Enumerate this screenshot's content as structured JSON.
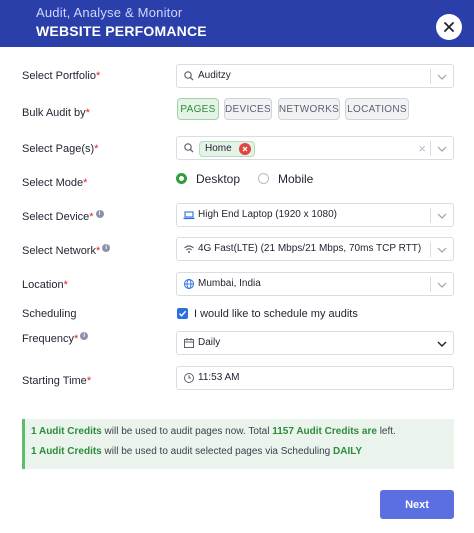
{
  "header": {
    "subtitle": "Audit, Analyse & Monitor",
    "title": "WEBSITE PERFOMANCE",
    "close_icon": "close-icon"
  },
  "form": {
    "portfolio": {
      "label": "Select Portfolio",
      "required": "*",
      "value": "Auditzy",
      "icon": "search-icon"
    },
    "bulk_audit": {
      "label": "Bulk Audit by",
      "required": "*",
      "options": [
        "PAGES",
        "DEVICES",
        "NETWORKS",
        "LOCATIONS"
      ],
      "selected": "PAGES"
    },
    "pages": {
      "label": "Select Page(s)",
      "required": "*",
      "tag": "Home",
      "clear_glyph": "×"
    },
    "mode": {
      "label": "Select Mode",
      "required": "*",
      "options": [
        "Desktop",
        "Mobile"
      ],
      "selected": "Desktop"
    },
    "device": {
      "label": "Select Device",
      "required": "*",
      "value": "High End Laptop (1920 x 1080)",
      "icon": "laptop-icon"
    },
    "network": {
      "label": "Select Network",
      "required": "*",
      "value": "4G Fast(LTE) (21 Mbps/21 Mbps, 70ms TCP RTT)",
      "icon": "wifi-icon"
    },
    "location": {
      "label": "Location",
      "required": "*",
      "value": "Mumbai, India",
      "icon": "globe-icon"
    },
    "scheduling": {
      "label": "Scheduling",
      "checkbox_label": "I would like to schedule my audits",
      "checked": true
    },
    "frequency": {
      "label": "Frequency",
      "required": "*",
      "value": "Daily",
      "icon": "calendar-icon"
    },
    "start_time": {
      "label": "Starting Time",
      "required": "*",
      "value": "11:53 AM",
      "icon": "clock-icon"
    }
  },
  "notice": {
    "line1": {
      "credits": "1 Audit Credits",
      "mid": " will be used to audit pages now. Total ",
      "total": "1157 Audit Credits are",
      "end": " left."
    },
    "line2": {
      "credits": "1 Audit Credits",
      "mid": " will be used to audit selected pages via Scheduling ",
      "freq": "DAILY"
    }
  },
  "actions": {
    "next_label": "Next"
  },
  "colors": {
    "header_bg": "#2b3faa",
    "accent_green": "#2e8b3b",
    "button_bg": "#5b6fe0"
  }
}
